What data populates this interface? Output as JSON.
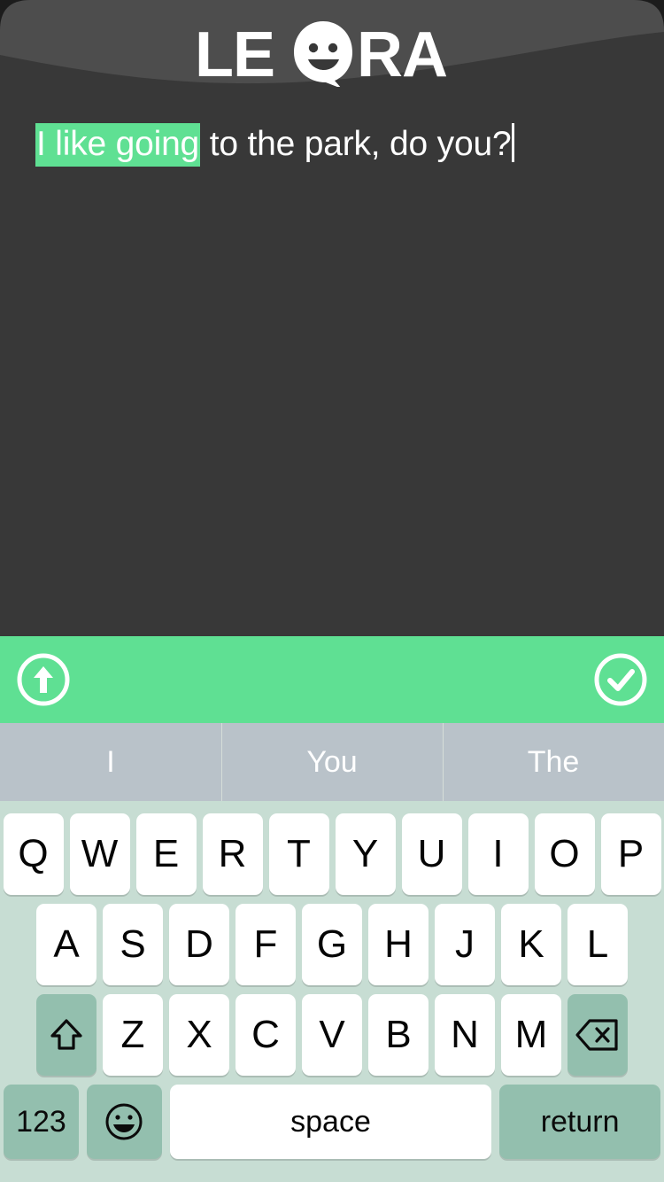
{
  "app": {
    "name": "Leora",
    "logo_text": "LEORA",
    "logo_letters_before": "LE",
    "logo_letters_after": "RA"
  },
  "theme": {
    "accent_green": "#5fe093",
    "header_dark": "#4d4d4d",
    "header_darker": "#383838",
    "compose_bg": "#383838",
    "prediction_bg": "#b9c2c9",
    "keyboard_bg": "#c7ddd3",
    "key_white": "#ffffff",
    "key_dark": "#93bfae",
    "text_white": "#ffffff"
  },
  "compose": {
    "selected_text": "I like going",
    "remaining_text": " to the park, do you?",
    "full_text": "I like going to the park, do you?",
    "caret_visible": true
  },
  "actionbar": {
    "speak_label": "arrow-up-circle",
    "confirm_label": "check-circle"
  },
  "predictions": {
    "items": [
      {
        "label": "I"
      },
      {
        "label": "You"
      },
      {
        "label": "The"
      }
    ]
  },
  "keyboard": {
    "row1": [
      "Q",
      "W",
      "E",
      "R",
      "T",
      "Y",
      "U",
      "I",
      "O",
      "P"
    ],
    "row2": [
      "A",
      "S",
      "D",
      "F",
      "G",
      "H",
      "J",
      "K",
      "L"
    ],
    "row3": [
      "Z",
      "X",
      "C",
      "V",
      "B",
      "N",
      "M"
    ],
    "shift_label": "shift",
    "backspace_label": "backspace",
    "numeric_label": "123",
    "emoji_label": "emoji",
    "space_label": "space",
    "return_label": "return"
  }
}
